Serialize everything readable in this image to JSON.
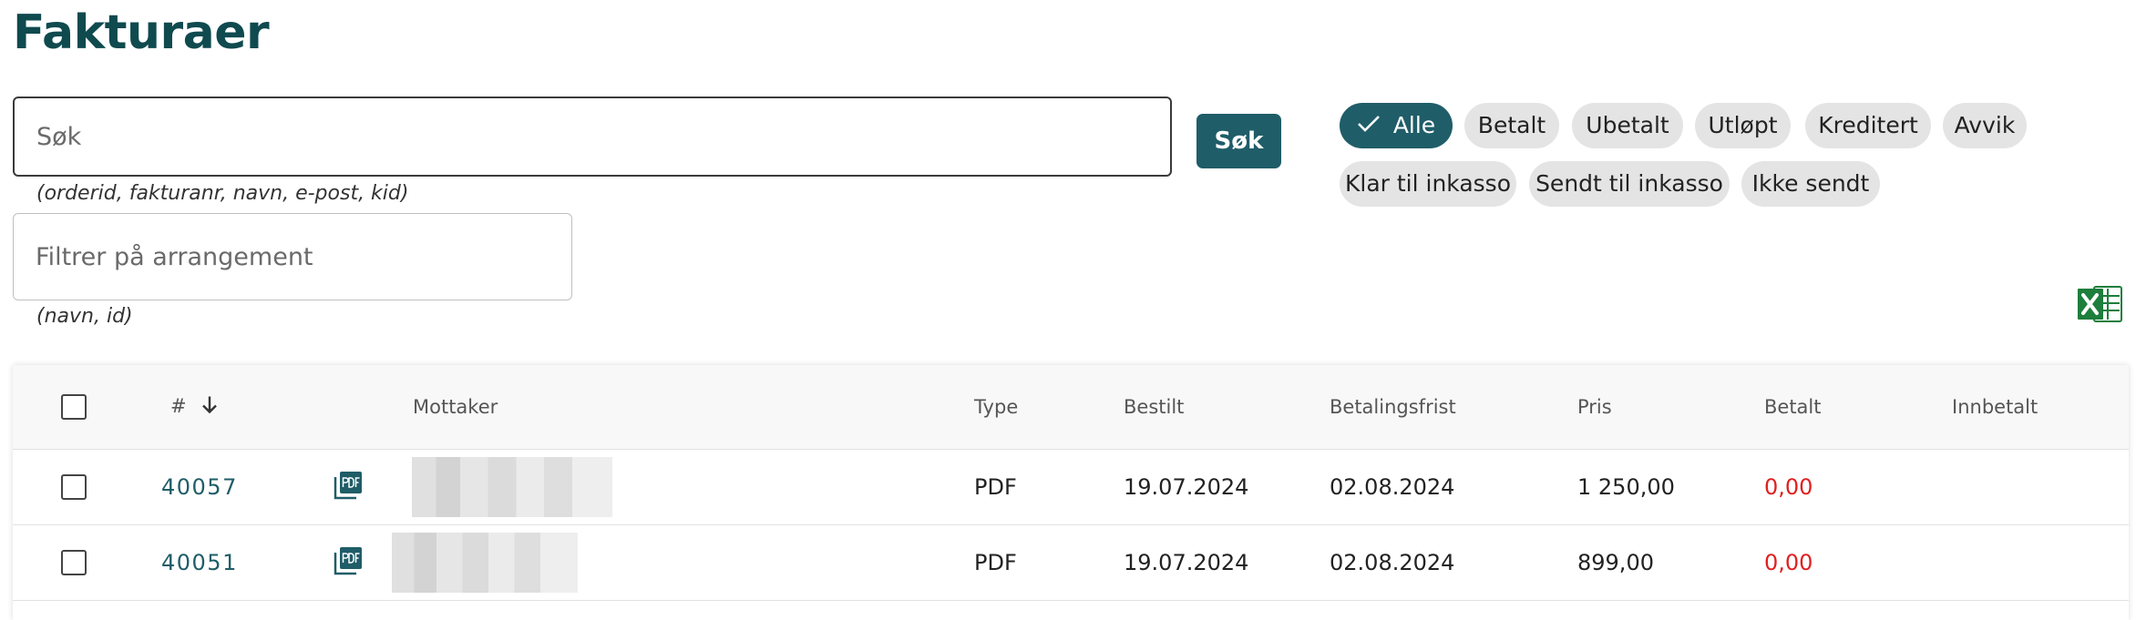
{
  "page": {
    "title": "Fakturaer"
  },
  "search": {
    "placeholder": "Søk",
    "hint": "(orderid, fakturanr, navn, e-post, kid)",
    "button_label": "Søk"
  },
  "event_filter": {
    "placeholder": "Filtrer på arrangement",
    "hint": "(navn, id)"
  },
  "status_filters": [
    {
      "label": "Alle",
      "active": true
    },
    {
      "label": "Betalt",
      "active": false
    },
    {
      "label": "Ubetalt",
      "active": false
    },
    {
      "label": "Utløpt",
      "active": false
    },
    {
      "label": "Kreditert",
      "active": false
    },
    {
      "label": "Avvik",
      "active": false
    },
    {
      "label": "Klar til inkasso",
      "active": false
    },
    {
      "label": "Sendt til inkasso",
      "active": false
    },
    {
      "label": "Ikke sendt",
      "active": false
    }
  ],
  "colors": {
    "accent": "#1f5d68",
    "title": "#0f4a4f",
    "unpaid": "#e02020",
    "excel": "#1e7e3c"
  },
  "icons": {
    "export": "excel-icon",
    "document": "pdf-icon",
    "sort": "arrow-down-icon",
    "check": "check-icon"
  },
  "table": {
    "headers": {
      "number": "#",
      "recipient": "Mottaker",
      "type": "Type",
      "ordered": "Bestilt",
      "due_date": "Betalingsfrist",
      "price": "Pris",
      "paid": "Betalt",
      "deposited": "Innbetalt"
    },
    "rows": [
      {
        "number": "40057",
        "type": "PDF",
        "ordered": "19.07.2024",
        "due_date": "02.08.2024",
        "price": "1 250,00",
        "paid": "0,00"
      },
      {
        "number": "40051",
        "type": "PDF",
        "ordered": "19.07.2024",
        "due_date": "02.08.2024",
        "price": "899,00",
        "paid": "0,00"
      }
    ]
  }
}
